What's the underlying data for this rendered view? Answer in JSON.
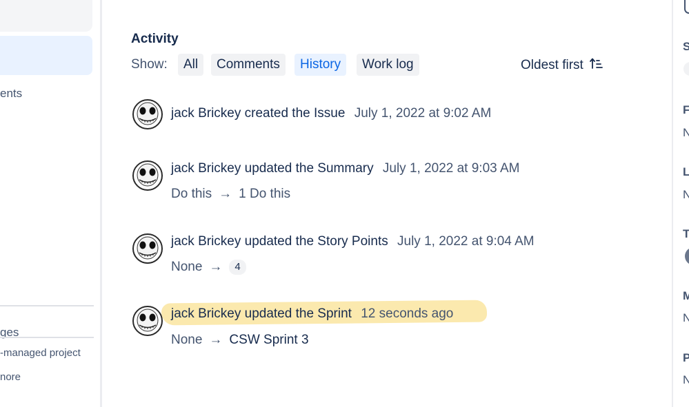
{
  "left_sidebar": {
    "item_partial_1": "ents",
    "item_partial_2": "ges",
    "item_partial_3": "-managed project",
    "item_partial_4": "nore"
  },
  "activity": {
    "title": "Activity",
    "show_label": "Show:",
    "filters": [
      "All",
      "Comments",
      "History",
      "Work log"
    ],
    "active_filter": "History",
    "sort_label": "Oldest first"
  },
  "entries": [
    {
      "user": "jack Brickey",
      "verb": "created the",
      "field": "Issue",
      "time": "July 1, 2022 at 9:02 AM"
    },
    {
      "user": "jack Brickey",
      "verb": "updated the",
      "field": "Summary",
      "time": "July 1, 2022 at 9:03 AM",
      "from": "Do this",
      "to": "1 Do this"
    },
    {
      "user": "jack Brickey",
      "verb": "updated the",
      "field": "Story Points",
      "time": "July 1, 2022 at 9:04 AM",
      "from": "None",
      "to": "4"
    },
    {
      "user": "jack Brickey",
      "verb": "updated the",
      "field": "Sprint",
      "time": "12 seconds ago",
      "from": "None",
      "to": "CSW Sprint 3"
    }
  ],
  "right_rail": {
    "letters": [
      "S",
      "F",
      "N",
      "L",
      "N",
      "T",
      "M",
      "N",
      "P",
      "N"
    ]
  },
  "colors": {
    "accent": "#0c66e4",
    "highlight": "#fbe7a5"
  }
}
